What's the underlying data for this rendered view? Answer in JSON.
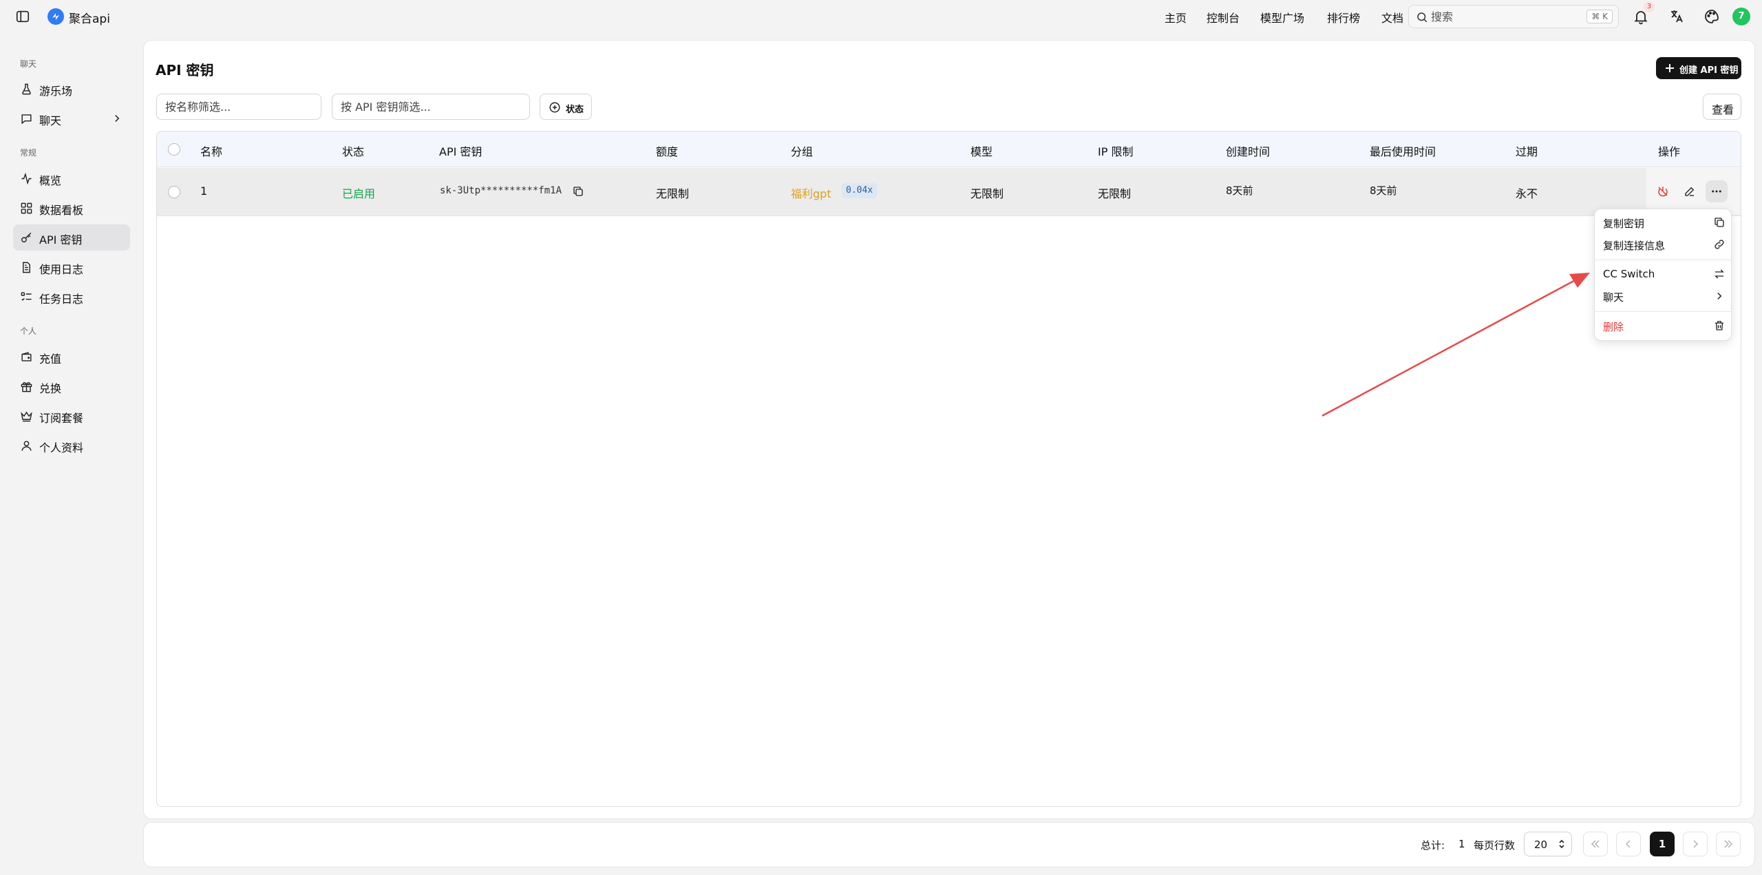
{
  "header": {
    "app_title": "聚合api",
    "nav": [
      "主页",
      "控制台",
      "模型广场",
      "排行榜",
      "文档"
    ],
    "search_placeholder": "搜索",
    "search_shortcut": "⌘ K",
    "notification_count": "3",
    "avatar_initial": "7",
    "avatar_color": "#22c55e"
  },
  "sidebar": {
    "section_chat": "聊天",
    "section_general": "常规",
    "section_personal": "个人",
    "items": [
      {
        "label": "游乐场",
        "icon": "flask-icon"
      },
      {
        "label": "聊天",
        "icon": "chat-icon"
      },
      {
        "label": "概览",
        "icon": "activity-icon"
      },
      {
        "label": "数据看板",
        "icon": "dashboard-icon"
      },
      {
        "label": "API 密钥",
        "icon": "key-icon"
      },
      {
        "label": "使用日志",
        "icon": "file-icon"
      },
      {
        "label": "任务日志",
        "icon": "tasks-icon"
      },
      {
        "label": "充值",
        "icon": "wallet-icon"
      },
      {
        "label": "兑换",
        "icon": "gift-icon"
      },
      {
        "label": "订阅套餐",
        "icon": "crown-icon"
      },
      {
        "label": "个人资料",
        "icon": "user-icon"
      }
    ],
    "active_item": "API 密钥"
  },
  "page": {
    "title": "API 密钥",
    "create_button": "创建 API 密钥",
    "filter_name_placeholder": "按名称筛选...",
    "filter_key_placeholder": "按 API 密钥筛选...",
    "status_filter_label": "状态",
    "view_button": "查看"
  },
  "table": {
    "columns": [
      "名称",
      "状态",
      "API 密钥",
      "额度",
      "分组",
      "模型",
      "IP 限制",
      "创建时间",
      "最后使用时间",
      "过期",
      "操作"
    ],
    "rows": [
      {
        "name": "1",
        "status": "已启用",
        "api_key": "sk-3Utp**********fm1A",
        "quota": "无限制",
        "group": "福利gpt",
        "group_rate": "0.04x",
        "models": "无限制",
        "ip_limit": "无限制",
        "created": "8天前",
        "last_used": "8天前",
        "expires": "永不"
      }
    ]
  },
  "row_menu": {
    "items": [
      {
        "label": "复制密钥",
        "icon": "copy-icon"
      },
      {
        "label": "复制连接信息",
        "icon": "link-icon"
      },
      {
        "label": "CC Switch",
        "icon": "switch-icon"
      },
      {
        "label": "聊天",
        "icon": "chevron-right-icon"
      },
      {
        "label": "删除",
        "icon": "trash-icon"
      }
    ]
  },
  "footer": {
    "total_label": "总计:",
    "total_value": "1",
    "rows_per_page_label": "每页行数",
    "rows_per_page_value": "20",
    "current_page": "1"
  },
  "colors": {
    "status_enabled": "#16a34a",
    "group_name": "#e0a020",
    "delete": "#e53935",
    "annotation_arrow": "#e84a4a",
    "primary_button": "#141414"
  }
}
